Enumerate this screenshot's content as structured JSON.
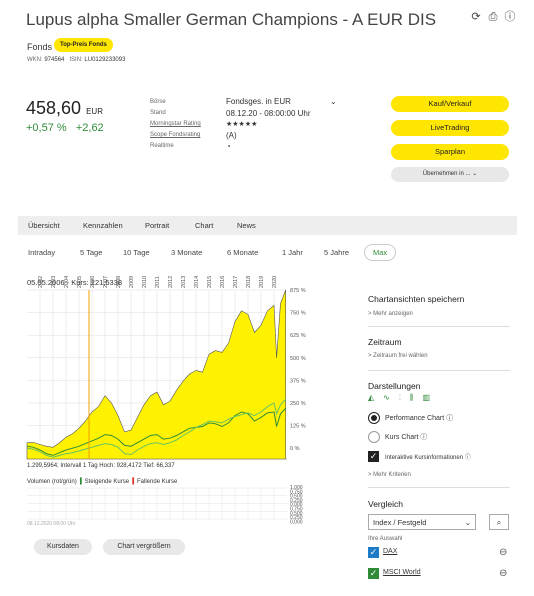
{
  "header": {
    "title": "Lupus alpha Smaller German Champions - A EUR DIS",
    "type_label": "Fonds",
    "badge": "Top-Preis Fonds",
    "wkn_label": "WKN:",
    "wkn": "974564",
    "isin_label": "ISIN:",
    "isin": "LU0129233093"
  },
  "quote": {
    "price": "458,60",
    "currency": "EUR",
    "change_pct": "+0,57 %",
    "change_abs": "+2,62"
  },
  "details": {
    "boerse_label": "Börse",
    "boerse_value": "Fondsges. in EUR",
    "stand_label": "Stand",
    "stand_value": "08.12.20 - 08:00:00 Uhr",
    "morningstar_label": "Morningstar Rating",
    "morningstar_value": "★★★★★",
    "scope_label": "Scope Fondsrating",
    "scope_value": "(A)",
    "realtime_label": "Realtime"
  },
  "actions": {
    "kauf": "Kauf/Verkauf",
    "livetrading": "LiveTrading",
    "sparplan": "Sparplan",
    "uebernehmen": "Übernehmen in ...  ⌄"
  },
  "tabs": [
    "Übersicht",
    "Kennzahlen",
    "Portrait",
    "Chart",
    "News"
  ],
  "ranges": [
    "Intraday",
    "5 Tage",
    "10 Tage",
    "3 Monate",
    "6 Monate",
    "1 Jahr",
    "5 Jahre",
    "Max"
  ],
  "chart": {
    "info": "05.05.2006  -  Kurs: 221,5338",
    "bottom_info": "1.299,5964;   Intervall 1 Tag     Hoch: 928,4172     Tief: 66,337",
    "volume_legend_a": "Volumen (rot/grün)",
    "volume_legend_b": "Steigende Kurse",
    "volume_legend_c": "Fallende Kurse",
    "timestamp": "08.12.2020 08:00 Uhr",
    "btn_kursdaten": "Kursdaten",
    "btn_vergroessern": "Chart vergrößern"
  },
  "chart_data": {
    "type": "area",
    "x_tick_labels": [
      "2002",
      "2003",
      "2004",
      "2005",
      "2006",
      "2007",
      "2008",
      "2009",
      "2010",
      "2011",
      "2012",
      "2013",
      "2014",
      "2015",
      "2016",
      "2017",
      "2018",
      "2019",
      "2020"
    ],
    "y_tick_labels": [
      "875 %",
      "750 %",
      "625 %",
      "500 %",
      "375 %",
      "250 %",
      "125 %",
      "0 %"
    ],
    "ylim": [
      0,
      875
    ],
    "volume_tick_labels": [
      "1,000",
      "0,750",
      "0,500",
      "0,250",
      "0,000",
      "0,750",
      "0,500",
      "0,250",
      "0,000"
    ],
    "x": [
      2001,
      2001.5,
      2002,
      2002.5,
      2003,
      2003.5,
      2004,
      2004.5,
      2005,
      2005.5,
      2006,
      2006.5,
      2007,
      2007.5,
      2008,
      2008.5,
      2009,
      2009.5,
      2010,
      2010.5,
      2011,
      2011.5,
      2012,
      2012.5,
      2013,
      2013.5,
      2014,
      2014.5,
      2015,
      2015.5,
      2016,
      2016.5,
      2017,
      2017.5,
      2018,
      2018.5,
      2019,
      2019.5,
      2020,
      2020.2,
      2020.5,
      2020.9
    ],
    "series": [
      {
        "name": "Lupus alpha Smaller German Champions - A EUR DIS",
        "values": [
          30,
          32,
          20,
          10,
          5,
          30,
          60,
          80,
          110,
          150,
          200,
          230,
          290,
          250,
          180,
          90,
          100,
          170,
          240,
          290,
          310,
          240,
          260,
          320,
          370,
          410,
          430,
          420,
          520,
          540,
          530,
          580,
          700,
          760,
          740,
          640,
          680,
          760,
          790,
          500,
          800,
          875
        ]
      },
      {
        "name": "DAX",
        "values": [
          10,
          5,
          -10,
          -30,
          -40,
          -25,
          -10,
          0,
          10,
          25,
          40,
          55,
          75,
          70,
          50,
          15,
          10,
          30,
          50,
          70,
          75,
          50,
          55,
          70,
          90,
          110,
          115,
          120,
          140,
          135,
          120,
          140,
          180,
          200,
          190,
          150,
          170,
          195,
          200,
          120,
          190,
          220
        ]
      },
      {
        "name": "MSCI World",
        "values": [
          0,
          -5,
          -20,
          -40,
          -50,
          -40,
          -30,
          -25,
          -15,
          -5,
          5,
          15,
          25,
          20,
          5,
          -30,
          -35,
          -10,
          10,
          25,
          30,
          20,
          30,
          45,
          70,
          90,
          115,
          130,
          150,
          145,
          140,
          160,
          175,
          185,
          195,
          180,
          200,
          230,
          250,
          190,
          240,
          270
        ]
      }
    ]
  },
  "right_panel": {
    "save_title": "Chartansichten speichern",
    "save_link": "Mehr anzeigen",
    "zeitraum_title": "Zeitraum",
    "zeitraum_link": "Zeitraum frei wählen",
    "darstellungen_title": "Darstellungen",
    "perf_chart": "Performance Chart",
    "kurs_chart": "Kurs Chart",
    "interaktiv": "Interaktive Kursinformationen",
    "kriterien_link": "Mehr Kriterien",
    "vergleich_title": "Vergleich",
    "vergleich_select": "Index / Festgeld",
    "ihre_auswahl": "Ihre Auswahl",
    "dax": "DAX",
    "msci": "MSCI World"
  },
  "colors": {
    "accent_yellow": "#ffe600",
    "positive_green": "#2e8b3a",
    "area_fill": "#fff200"
  }
}
